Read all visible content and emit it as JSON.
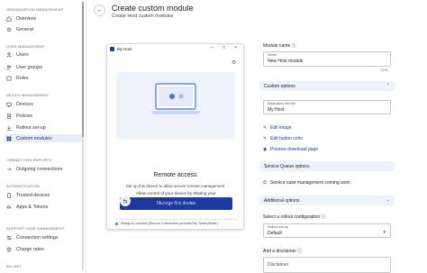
{
  "sidebar": {
    "sections": [
      {
        "title": "ORGANIZATION MANAGEMENT",
        "items": [
          {
            "label": "Overview",
            "icon": "home-icon"
          },
          {
            "label": "General",
            "icon": "gear-icon"
          }
        ]
      },
      {
        "title": "USER MANAGEMENT",
        "items": [
          {
            "label": "Users",
            "icon": "user-icon"
          },
          {
            "label": "User groups",
            "icon": "users-icon"
          },
          {
            "label": "Roles",
            "icon": "role-icon"
          }
        ]
      },
      {
        "title": "DEVICE MANAGEMENT",
        "items": [
          {
            "label": "Devices",
            "icon": "device-icon"
          },
          {
            "label": "Policies",
            "icon": "policy-icon"
          },
          {
            "label": "Rollout set-up",
            "icon": "rollout-icon"
          },
          {
            "label": "Custom modules",
            "icon": "module-icon"
          }
        ]
      },
      {
        "title": "CONNECTION REPORTS",
        "items": [
          {
            "label": "Outgoing connections",
            "icon": "connection-icon"
          }
        ]
      },
      {
        "title": "AUTHENTICATION",
        "items": [
          {
            "label": "Trusted devices",
            "icon": "trusted-device-icon"
          },
          {
            "label": "Apps & Tokens",
            "icon": "token-icon"
          }
        ]
      },
      {
        "title": "SUPPORT CASE MANAGEMENT",
        "items": [
          {
            "label": "Connection settings",
            "icon": "settings-icon"
          },
          {
            "label": "Charge rates",
            "icon": "charge-icon"
          }
        ]
      },
      {
        "title": "BILLING",
        "items": []
      }
    ],
    "active": "Custom modules"
  },
  "header": {
    "title": "Create custom module",
    "subtitle": "Create Host custom modules"
  },
  "preview": {
    "window_title": "My Host",
    "remote_title": "Remote access",
    "remote_sub": "Set up this device to allow secure remote management",
    "manage_button": "Manage this device",
    "share_text_1": "Allow control of your device by sharing your",
    "share_text_2": "ID and password",
    "share_link": "Connect with TeamViewer ID",
    "ready_text": "Ready to connect (Secure Connection provided by TeamViewer)"
  },
  "form": {
    "module_name_label": "Module name",
    "module_name_field_label": "Name",
    "module_name_value": "New Host module",
    "module_name_counter": "15/50",
    "custom_options_label": "Custom options",
    "app_bar_title_label": "Application bar title",
    "app_bar_title_value": "My Host",
    "edit_image": "Edit image",
    "edit_button_color": "Edit button color",
    "preview_download": "Preview download page",
    "service_queue_label": "Service Queue options",
    "service_case_text": "Service case management coming soon",
    "additional_options_label": "Additional options",
    "rollout_config_label": "Select a rollout configuration",
    "rollout_field_label": "Rollout set-up",
    "rollout_value": "Default",
    "disclaimer_label": "Add a disclaimer",
    "disclaimer_placeholder": "Disclaimer"
  },
  "colors": {
    "accent": "#1d3aa2",
    "active_bg": "#e9edf7",
    "section_bg": "#eef2fb"
  }
}
